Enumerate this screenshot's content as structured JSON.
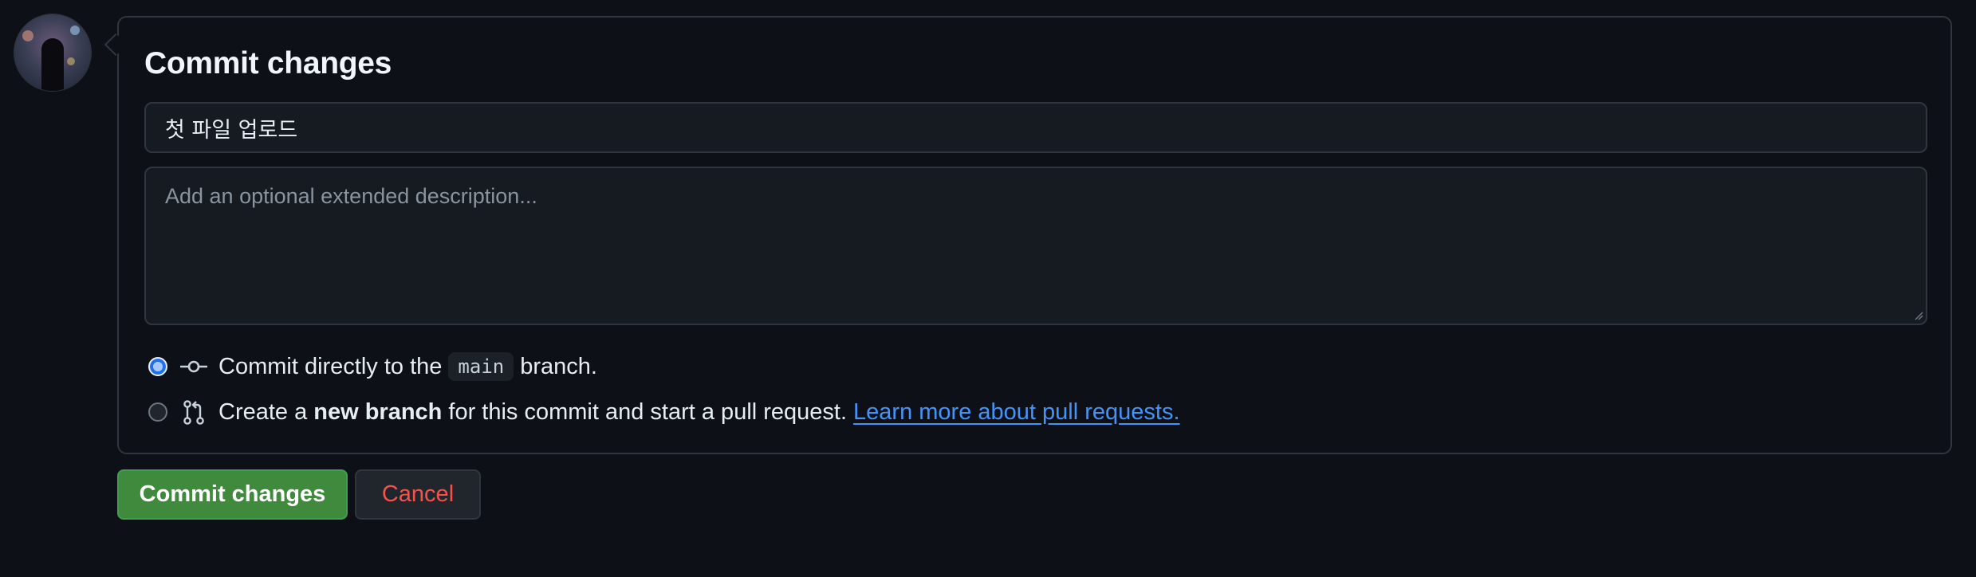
{
  "form": {
    "title": "Commit changes",
    "message_value": "첫 파일 업로드",
    "description_placeholder": "Add an optional extended description..."
  },
  "options": {
    "direct": {
      "prefix": "Commit directly to the",
      "branch": "main",
      "suffix": "branch.",
      "selected": true
    },
    "new_branch": {
      "prefix": "Create a",
      "bold": "new branch",
      "suffix": "for this commit and start a pull request.",
      "link": "Learn more about pull requests.",
      "selected": false
    }
  },
  "buttons": {
    "commit": "Commit changes",
    "cancel": "Cancel"
  },
  "icons": {
    "commit": "git-commit-icon",
    "pull_request": "git-pull-request-icon",
    "avatar": "user-avatar"
  },
  "colors": {
    "background": "#0d1117",
    "accent_green": "#238636",
    "link": "#4493f8",
    "danger": "#f85149"
  }
}
